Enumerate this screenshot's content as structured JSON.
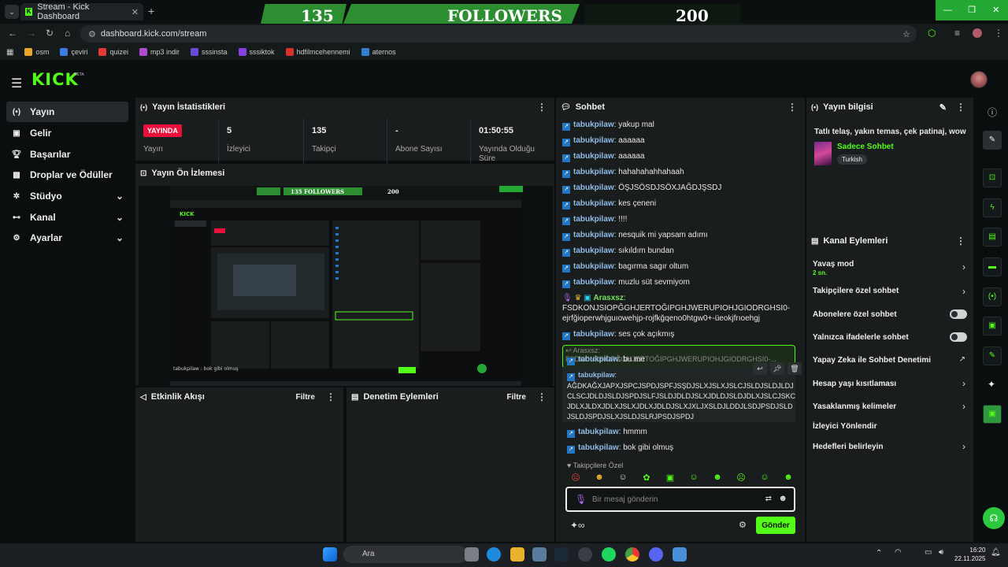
{
  "browser": {
    "tab_title": "Stream - Kick Dashboard",
    "url": "dashboard.kick.com/stream",
    "bookmarks": [
      "osm",
      "çeviri",
      "quizei",
      "mp3 indir",
      "sssinsta",
      "sssiktok",
      "hdfilmcehennemi",
      "aternos"
    ]
  },
  "banner": {
    "left": "135",
    "center": "FOLLOWERS",
    "right": "200"
  },
  "header": {
    "logo": "KICK",
    "beta": "BETA"
  },
  "sidebar": {
    "items": [
      {
        "label": "Yayın"
      },
      {
        "label": "Gelir"
      },
      {
        "label": "Başarılar"
      },
      {
        "label": "Droplar ve Ödüller"
      },
      {
        "label": "Stüdyo"
      },
      {
        "label": "Kanal"
      },
      {
        "label": "Ayarlar"
      }
    ]
  },
  "stats": {
    "title": "Yayın İstatistikleri",
    "live_badge": "YAYINDA",
    "live_label": "Yayın",
    "viewers_value": "5",
    "viewers_label": "İzleyici",
    "followers_value": "135",
    "followers_label": "Takipçi",
    "subs_value": "-",
    "subs_label": "Abone Sayısı",
    "uptime_value": "01:50:55",
    "uptime_label": "Yayında Olduğu Süre"
  },
  "preview": {
    "title": "Yayın Ön İzlemesi"
  },
  "activity": {
    "title": "Etkinlik Akışı",
    "filter": "Filtre"
  },
  "moderation": {
    "title": "Denetim Eylemleri",
    "filter": "Filtre"
  },
  "chat": {
    "title": "Sohbet",
    "messages": [
      {
        "user": "tabukpilaw",
        "text": "yakup mal"
      },
      {
        "user": "tabukpilaw",
        "text": "aaaaaa"
      },
      {
        "user": "tabukpilaw",
        "text": "aaaaaa"
      },
      {
        "user": "tabukpilaw",
        "text": "hahahahahhahaah"
      },
      {
        "user": "tabukpilaw",
        "text": "ÖŞJSÖSDJSÖXJAĞDJŞSDJ"
      },
      {
        "user": "tabukpilaw",
        "text": "kes çeneni"
      },
      {
        "user": "tabukpilaw",
        "text": "!!!!"
      },
      {
        "user": "tabukpilaw",
        "text": "nesquik mi yapsam adımı"
      },
      {
        "user": "tabukpilaw",
        "text": "sıkıldım bundan"
      },
      {
        "user": "tabukpilaw",
        "text": "bagırma sagır oltum"
      },
      {
        "user": "tabukpilaw",
        "text": "muzlu süt sevmiyom"
      }
    ],
    "arasxsz_user": "Arasxsz",
    "arasxsz_line1": "FSDKONJSIOPĞGHJERTOĞIPGHJWERUPIOHJGIODRGHSI0-",
    "arasxsz_line2": "ejrfğioperwhjguıowehjp-rojfkğqeno0htgw0+-üeokjfrıoehgj",
    "msg_after1_user": "tabukpilaw",
    "msg_after1_text": "ses çok açıkmış",
    "reply_to": "Arasxsz: FSDKONJSIOPĞGHJERTOĞIPGHJWERUPIOHJGIODRGHSI0-...",
    "reply_user": "tabukpilaw",
    "reply_text": "bu me",
    "long_user": "tabukpilaw",
    "long_l1": "AĞDKAĞXJAPXJSPCJSPDJSPFJSŞDJSLXJSLXJSLCJSLDJSLDJLDJ",
    "long_l2": "CLSCJDLDJSLDJSPDJSLFJSLDJDLDJSLXJDLDJSLDJDLXJSLCJSKC",
    "long_l3": "JDLXJLDXJDLXJSLXJDLXJDLDJSLXJXLJXSLDJLDDJLSDJPSDJSLD",
    "long_l4": "JSLDJSPDJSLXJSLDJSLRJPSDJSPDJ",
    "m_hmmm_user": "tabukpilaw",
    "m_hmmm_text": "hmmm",
    "m_bok_user": "tabukpilaw",
    "m_bok_text": "bok gibi olmuş",
    "followers_only": "Takipçilere Özel",
    "input_placeholder": "Bir mesaj gönderin",
    "send_label": "Gönder"
  },
  "stream_info": {
    "title": "Yayın bilgisi",
    "stream_title": "Tatlı telaş, yakın temas, çek patinaj, wow",
    "category": "Sadece Sohbet",
    "tag": "Turkish"
  },
  "channel_actions": {
    "title": "Kanal Eylemleri",
    "slow_mode": "Yavaş mod",
    "slow_mode_value": "2 sn.",
    "followers_chat": "Takipçilere özel sohbet",
    "subs_chat": "Abonelere özel sohbet",
    "emote_chat": "Yalnızca ifadelerle sohbet",
    "ai_moderation": "Yapay Zeka ile Sohbet Denetimi",
    "account_age": "Hesap yaşı kısıtlaması",
    "banned_words": "Yasaklanmış kelimeler",
    "redirect": "İzleyici Yönlendir",
    "goals": "Hedefleri belirleyin"
  },
  "taskbar": {
    "search": "Ara",
    "time": "16:20",
    "date": "22.11.2025"
  }
}
